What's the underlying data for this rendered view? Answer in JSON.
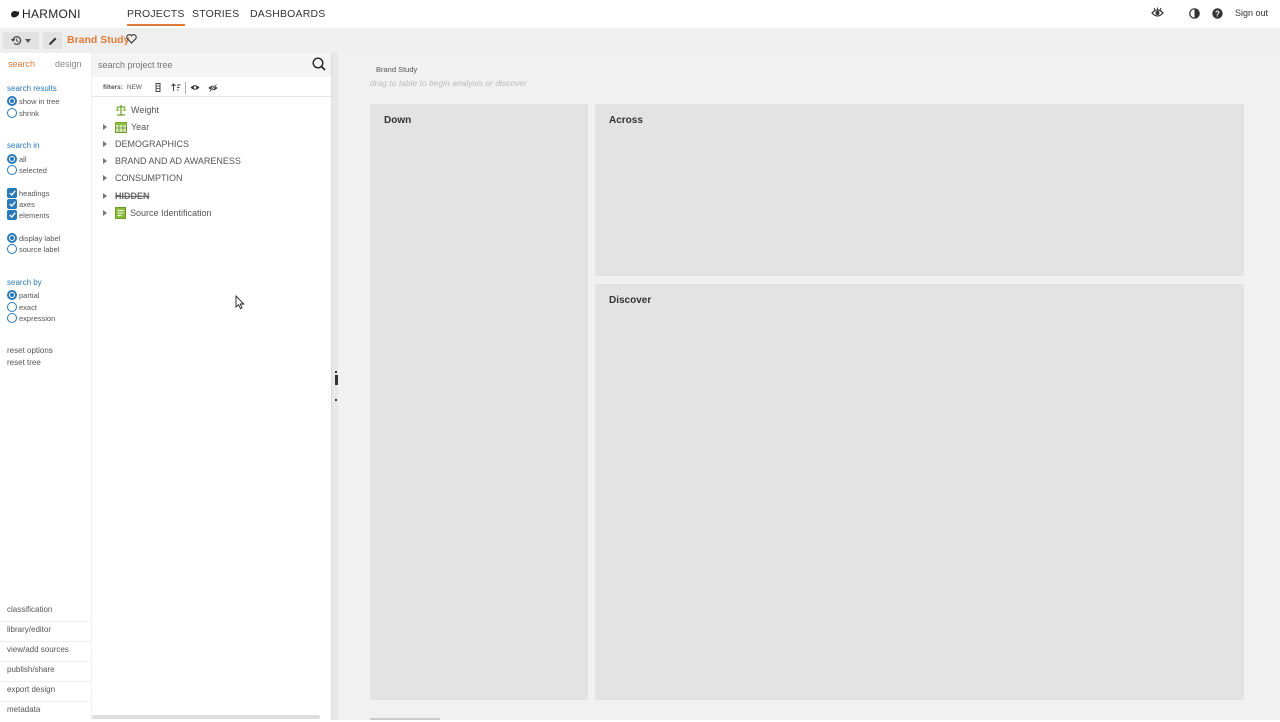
{
  "app": {
    "logo_text": "HARMONI",
    "nav_tabs": [
      {
        "label": "PROJECTS",
        "active": true
      },
      {
        "label": "STORIES",
        "active": false
      },
      {
        "label": "DASHBOARDS",
        "active": false
      }
    ],
    "signout_label": "Sign out",
    "accent_color": "#e07b39",
    "link_color": "#2a7ab8"
  },
  "project": {
    "title": "Brand Study"
  },
  "sidebar": {
    "tabs": [
      {
        "label": "search",
        "active": true
      },
      {
        "label": "design",
        "active": false
      }
    ],
    "search_results": {
      "heading": "search results",
      "options": [
        {
          "label": "show in tree",
          "selected": true
        },
        {
          "label": "shrink",
          "selected": false
        }
      ]
    },
    "search_in": {
      "heading": "search in",
      "scope_options": [
        {
          "label": "all",
          "selected": true
        },
        {
          "label": "selected",
          "selected": false
        }
      ],
      "checkboxes": [
        {
          "label": "headings",
          "checked": true
        },
        {
          "label": "axes",
          "checked": true
        },
        {
          "label": "elements",
          "checked": true
        }
      ],
      "label_options": [
        {
          "label": "display label",
          "selected": true
        },
        {
          "label": "source label",
          "selected": false
        }
      ]
    },
    "search_by": {
      "heading": "search by",
      "options": [
        {
          "label": "partial",
          "selected": true
        },
        {
          "label": "exact",
          "selected": false
        },
        {
          "label": "expression",
          "selected": false
        }
      ]
    },
    "reset_options": "reset options",
    "reset_tree": "reset tree",
    "bottom_links": [
      "classification",
      "library/editor",
      "view/add sources",
      "publish/share",
      "export design",
      "metadata"
    ]
  },
  "tree": {
    "search_placeholder": "search project tree",
    "filters_label": "filters:",
    "filters_new": "NEW",
    "nodes": [
      {
        "label": "Weight",
        "icon": "weight-icon",
        "expandable": false,
        "style": "normal"
      },
      {
        "label": "Year",
        "icon": "table-icon",
        "expandable": true,
        "style": "normal"
      },
      {
        "label": "DEMOGRAPHICS",
        "icon": "",
        "expandable": true,
        "style": "folder"
      },
      {
        "label": "BRAND AND AD AWARENESS",
        "icon": "",
        "expandable": true,
        "style": "folder"
      },
      {
        "label": "CONSUMPTION",
        "icon": "",
        "expandable": true,
        "style": "folder"
      },
      {
        "label": "HIDDEN",
        "icon": "",
        "expandable": true,
        "style": "hidden"
      },
      {
        "label": "Source Identification",
        "icon": "source-icon",
        "expandable": true,
        "style": "normal"
      }
    ]
  },
  "canvas": {
    "breadcrumb": "Brand Study",
    "hint": "drag to table to begin analysis or discover",
    "panels": {
      "down": "Down",
      "across": "Across",
      "discover": "Discover"
    }
  }
}
